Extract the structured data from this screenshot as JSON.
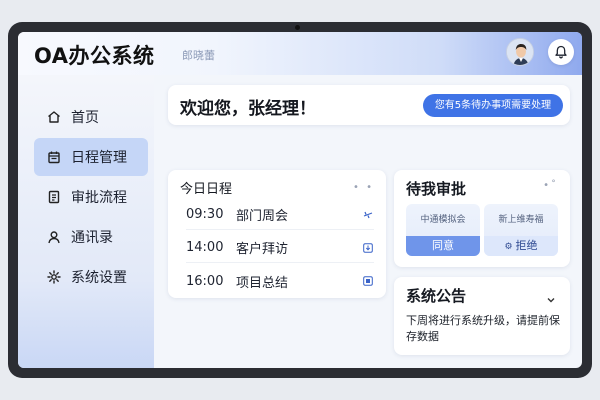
{
  "app": {
    "title": "OA办公系统",
    "user_subtitle": "郎晓蕾"
  },
  "header": {
    "avatar_icon": "user-avatar",
    "bell_icon": "bell-icon"
  },
  "sidebar": {
    "items": [
      {
        "label": "首页",
        "icon": "home-icon",
        "active": false
      },
      {
        "label": "日程管理",
        "icon": "calendar-icon",
        "active": true
      },
      {
        "label": "审批流程",
        "icon": "document-icon",
        "active": false
      },
      {
        "label": "通讯录",
        "icon": "person-icon",
        "active": false
      },
      {
        "label": "系统设置",
        "icon": "gear-icon",
        "active": false
      }
    ]
  },
  "welcome": {
    "greeting": "欢迎您，张经理！",
    "todo_button": "您有5条待办事项需要处理"
  },
  "schedule": {
    "title": "今日日程",
    "items": [
      {
        "time": "09:30",
        "name": "部门周会",
        "icon": "plane-icon"
      },
      {
        "time": "14:00",
        "name": "客户拜访",
        "icon": "download-icon"
      },
      {
        "time": "16:00",
        "name": "项目总结",
        "icon": "list-icon"
      }
    ]
  },
  "approval": {
    "title": "待我审批",
    "items": [
      {
        "label": "中通模拟会",
        "action": "同意"
      },
      {
        "label": "新上维寿福",
        "action": "拒绝"
      }
    ]
  },
  "notice": {
    "title": "系统公告",
    "text": "下周将进行系统升级，请提前保存数据"
  },
  "colors": {
    "accent": "#3f73e6",
    "sidebar_active": "#c5d6f7"
  }
}
